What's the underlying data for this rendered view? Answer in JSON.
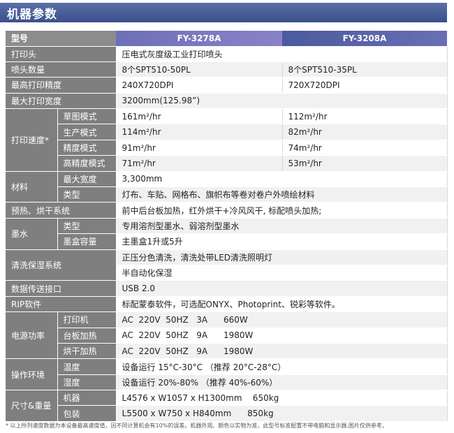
{
  "title": "机器参数",
  "header": {
    "label": "型号",
    "model_a": "FY-3278A",
    "model_b": "FY-3208A"
  },
  "rows": {
    "print_head": {
      "label": "打印头",
      "value": "压电式灰度级工业打印喷头"
    },
    "nozzles": {
      "label": "喷头数量",
      "a": "8个SPT510-50PL",
      "b": "8个SPT510-35PL"
    },
    "precision": {
      "label": "最高打印精度",
      "a": "240X720DPI",
      "b": "720X720DPI"
    },
    "width": {
      "label": "最大打印宽度",
      "value": "3200mm(125.98”)"
    },
    "speed": {
      "label": "打印速度*",
      "draft": {
        "label": "草图模式",
        "a": "161m²/hr",
        "b": "112m²/hr"
      },
      "production": {
        "label": "生产模式",
        "a": "114m²/hr",
        "b": "82m²/hr"
      },
      "fine": {
        "label": "精度模式",
        "a": "91m²/hr",
        "b": "74m²/hr"
      },
      "high": {
        "label": "高精度模式",
        "a": "71m²/hr",
        "b": "53m²/hr"
      }
    },
    "material": {
      "label": "材料",
      "max_width": {
        "label": "最大宽度",
        "value": "3,300mm"
      },
      "type": {
        "label": "类型",
        "value": "灯布、车贴、网格布、旗帜布等卷对卷户外喷绘材料"
      }
    },
    "heating": {
      "label": "预热、烘干系统",
      "value": "前中后台板加热，红外烘干+冷风风干, 标配喷头加热;"
    },
    "ink": {
      "label": "墨水",
      "type": {
        "label": "类型",
        "value": "专用溶剂型墨水、弱溶剂型墨水"
      },
      "capacity": {
        "label": "墨盒容量",
        "value": "主墨盒1升或5升"
      }
    },
    "cleaning": {
      "label": "清洗保湿系统",
      "line1": "正压分色清洗，清洗处带LED清洗照明灯",
      "line2": "半自动化保湿"
    },
    "interface": {
      "label": "数据传送接口",
      "value": "USB 2.0"
    },
    "rip": {
      "label": "RIP软件",
      "value": "标配蒙泰软件，可选配ONYX、Photoprint、锐彩等软件。"
    },
    "power": {
      "label": "电源功率",
      "printer": {
        "label": "打印机",
        "value": "AC  220V  50HZ   3A      660W"
      },
      "platen": {
        "label": "台板加热",
        "value": "AC  220V  50HZ   9A      1980W"
      },
      "dryer": {
        "label": "烘干加热",
        "value": "AC  220V  50HZ   9A      1980W"
      }
    },
    "environment": {
      "label": "操作环境",
      "temp": {
        "label": "温度",
        "value": "设备运行  15°C-30°C （推荐  20°C-28°C）"
      },
      "humidity": {
        "label": "湿度",
        "value": "设备运行  20%-80%  （推荐  40%-60%）"
      }
    },
    "size": {
      "label": "尺寸&重量",
      "machine": {
        "label": "机器",
        "value": "L4576 x W1057 x H1300mm    650kg"
      },
      "package": {
        "label": "包装",
        "value": "L5500 x W750 x H840mm      850kg"
      }
    }
  },
  "footnote": "* 以上所列速度数据为本设备最高速度值，因不同计算机会有10%的误差。机器外观、颜色以实物为准，此型号标准配置不带电脑和显示器,图片仅供参考。"
}
